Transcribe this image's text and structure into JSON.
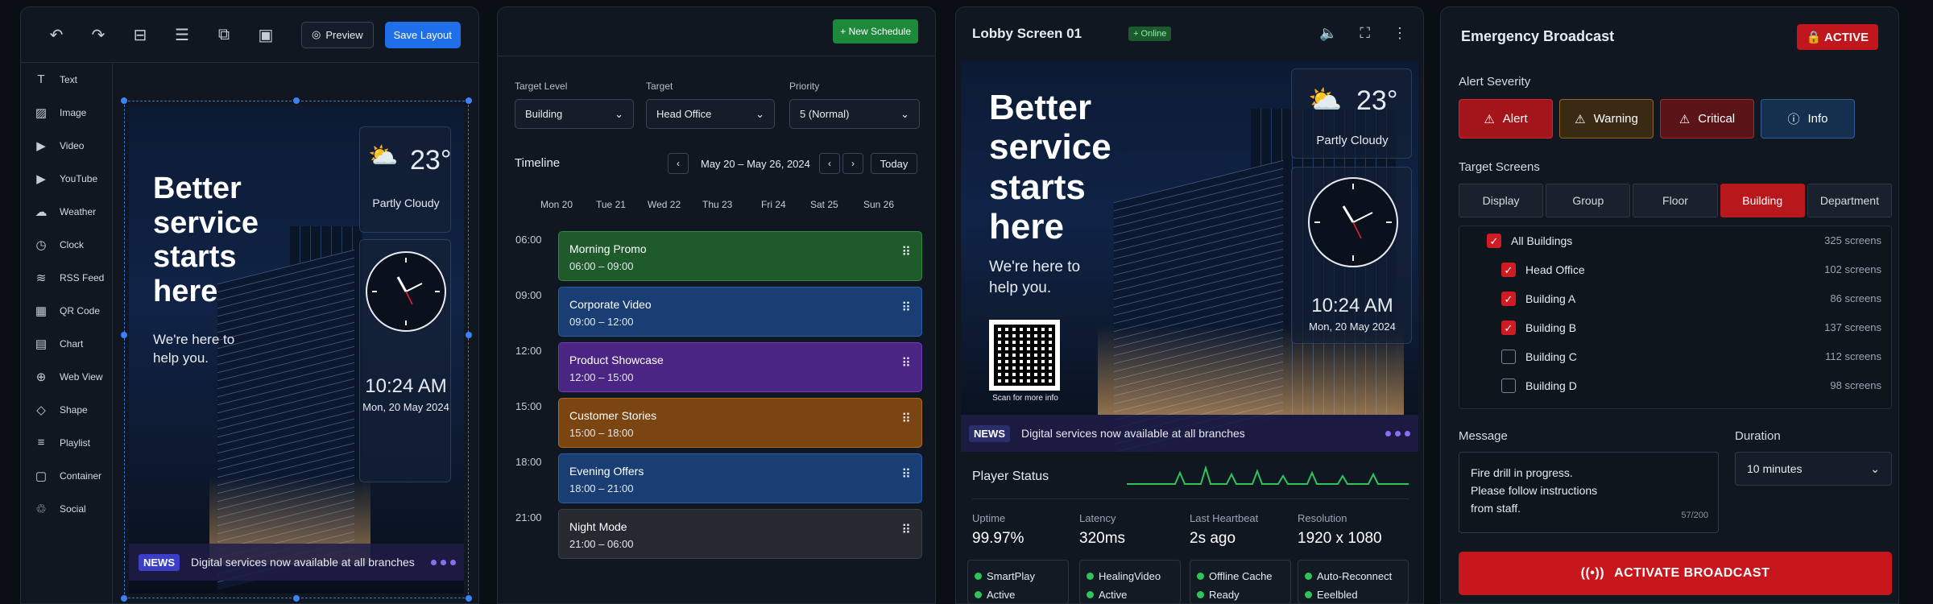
{
  "designer": {
    "toolbar": {
      "icons": [
        "undo-icon",
        "redo-icon",
        "align-icon",
        "distribute-icon",
        "layers-icon",
        "grid-icon"
      ],
      "preview_label": "Preview",
      "save_label": "Save Layout"
    },
    "widgets": [
      {
        "label": "Text",
        "icon": "T"
      },
      {
        "label": "Image",
        "icon": "▨"
      },
      {
        "label": "Video",
        "icon": "▶"
      },
      {
        "label": "YouTube",
        "icon": "▶"
      },
      {
        "label": "Weather",
        "icon": "☁"
      },
      {
        "label": "Clock",
        "icon": "◷"
      },
      {
        "label": "RSS Feed",
        "icon": "≋"
      },
      {
        "label": "QR Code",
        "icon": "▦"
      },
      {
        "label": "Chart",
        "icon": "▤"
      },
      {
        "label": "Web View",
        "icon": "⊕"
      },
      {
        "label": "Shape",
        "icon": "◇"
      },
      {
        "label": "Playlist",
        "icon": "≡"
      },
      {
        "label": "Container",
        "icon": "▢"
      },
      {
        "label": "Social",
        "icon": "♲"
      }
    ],
    "sign": {
      "headline": [
        "Better",
        "service",
        "starts",
        "here"
      ],
      "subline": [
        "We're here to",
        "help you."
      ],
      "temp": "23°",
      "condition": "Partly Cloudy",
      "time": "10:24 AM",
      "date": "Mon, 20 May 2024",
      "news_badge": "NEWS",
      "news_text": "Digital services now available at all branches"
    }
  },
  "scheduler": {
    "new_label": "+ New Schedule",
    "target_level": {
      "label": "Target Level",
      "value": "Building"
    },
    "target": {
      "label": "Target",
      "value": "Head Office"
    },
    "priority": {
      "label": "Priority",
      "value": "5 (Normal)"
    },
    "timeline_label": "Timeline",
    "range": "May 20 – May 26, 2024",
    "today_label": "Today",
    "days": [
      "Mon 20",
      "Tue 21",
      "Wed 22",
      "Thu 23",
      "Fri 24",
      "Sat 25",
      "Sun 26"
    ],
    "times": [
      "06:00",
      "09:00",
      "12:00",
      "15:00",
      "18:00",
      "21:00"
    ],
    "events": [
      {
        "title": "Morning Promo",
        "range": "06:00 – 09:00",
        "bg": "#1e5a2a",
        "border": "#2f8a3e"
      },
      {
        "title": "Corporate Video",
        "range": "09:00 – 12:00",
        "bg": "#183e74",
        "border": "#2a5fa8"
      },
      {
        "title": "Product Showcase",
        "range": "12:00 – 15:00",
        "bg": "#4a2584",
        "border": "#6a3cb8"
      },
      {
        "title": "Customer Stories",
        "range": "15:00 – 18:00",
        "bg": "#7a4510",
        "border": "#b06a1e"
      },
      {
        "title": "Evening Offers",
        "range": "18:00 – 21:00",
        "bg": "#183e74",
        "border": "#2a5fa8"
      },
      {
        "title": "Night Mode",
        "range": "21:00 – 06:00",
        "bg": "#262a30",
        "border": "#3a4048"
      }
    ]
  },
  "player": {
    "title": "Lobby Screen 01",
    "status_badge": "+ Online",
    "sign": {
      "headline": [
        "Better",
        "service",
        "starts",
        "here"
      ],
      "subline": [
        "We're here to",
        "help you."
      ],
      "temp": "23°",
      "condition": "Partly Cloudy",
      "time": "10:24 AM",
      "date": "Mon, 20 May 2024",
      "qr_caption": "Scan for more info",
      "news_badge": "NEWS",
      "news_text": "Digital services now available at all branches"
    },
    "status_title": "Player Status",
    "stats": [
      {
        "label": "Uptime",
        "value": "99.97%"
      },
      {
        "label": "Latency",
        "value": "320ms"
      },
      {
        "label": "Last Heartbeat",
        "value": "2s ago"
      },
      {
        "label": "Resolution",
        "value": "1920 x 1080"
      }
    ],
    "chips": [
      {
        "a": "SmartPlay",
        "b": "Active"
      },
      {
        "a": "HealingVideo",
        "b": "Active"
      },
      {
        "a": "Offline Cache",
        "b": "Ready"
      },
      {
        "a": "Auto-Reconnect",
        "b": "Eeelbled"
      }
    ]
  },
  "broadcast": {
    "title": "Emergency Broadcast",
    "active_label": "ACTIVE",
    "severity_label": "Alert Severity",
    "severities": [
      {
        "label": "Alert",
        "bg": "#a3151b",
        "border": "#d0262c",
        "icon": "⚠"
      },
      {
        "label": "Warning",
        "bg": "#3a2a14",
        "border": "#8a6a2a",
        "icon": "⚠"
      },
      {
        "label": "Critical",
        "bg": "#5a1418",
        "border": "#a42a30",
        "icon": "⚠"
      },
      {
        "label": "Info",
        "bg": "#14304e",
        "border": "#2d5f96",
        "icon": "ⓘ"
      }
    ],
    "targets_label": "Target Screens",
    "tabs": [
      "Display",
      "Group",
      "Floor",
      "Building",
      "Department"
    ],
    "active_tab": "Building",
    "rows": [
      {
        "name": "All Buildings",
        "count": "325 screens",
        "checked": true,
        "indent": false
      },
      {
        "name": "Head Office",
        "count": "102 screens",
        "checked": true,
        "indent": true
      },
      {
        "name": "Building A",
        "count": "86 screens",
        "checked": true,
        "indent": true
      },
      {
        "name": "Building B",
        "count": "137 screens",
        "checked": true,
        "indent": true
      },
      {
        "name": "Building C",
        "count": "112 screens",
        "checked": false,
        "indent": true
      },
      {
        "name": "Building D",
        "count": "98 screens",
        "checked": false,
        "indent": true
      }
    ],
    "message_label": "Message",
    "message_lines": [
      "Fire drill in progress.",
      "Please follow instructions",
      "from staff."
    ],
    "message_count": "57/200",
    "duration_label": "Duration",
    "duration_value": "10 minutes",
    "activate_label": "ACTIVATE BROADCAST"
  }
}
